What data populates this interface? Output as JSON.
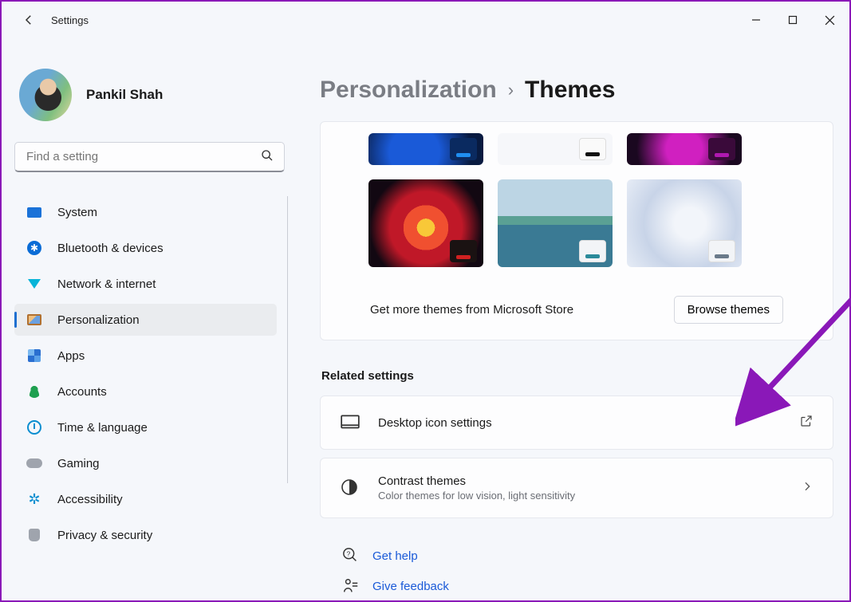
{
  "app": {
    "title": "Settings"
  },
  "user": {
    "name": "Pankil Shah"
  },
  "search": {
    "placeholder": "Find a setting"
  },
  "sidebar": {
    "items": [
      {
        "label": "System"
      },
      {
        "label": "Bluetooth & devices"
      },
      {
        "label": "Network & internet"
      },
      {
        "label": "Personalization"
      },
      {
        "label": "Apps"
      },
      {
        "label": "Accounts"
      },
      {
        "label": "Time & language"
      },
      {
        "label": "Gaming"
      },
      {
        "label": "Accessibility"
      },
      {
        "label": "Privacy & security"
      }
    ],
    "selected_index": 3
  },
  "breadcrumb": {
    "parent": "Personalization",
    "current": "Themes"
  },
  "themes": {
    "more_text": "Get more themes from Microsoft Store",
    "browse_label": "Browse themes"
  },
  "related": {
    "section_title": "Related settings",
    "desktop_icons": {
      "title": "Desktop icon settings"
    },
    "contrast": {
      "title": "Contrast themes",
      "subtitle": "Color themes for low vision, light sensitivity"
    }
  },
  "footer": {
    "help": "Get help",
    "feedback": "Give feedback"
  }
}
